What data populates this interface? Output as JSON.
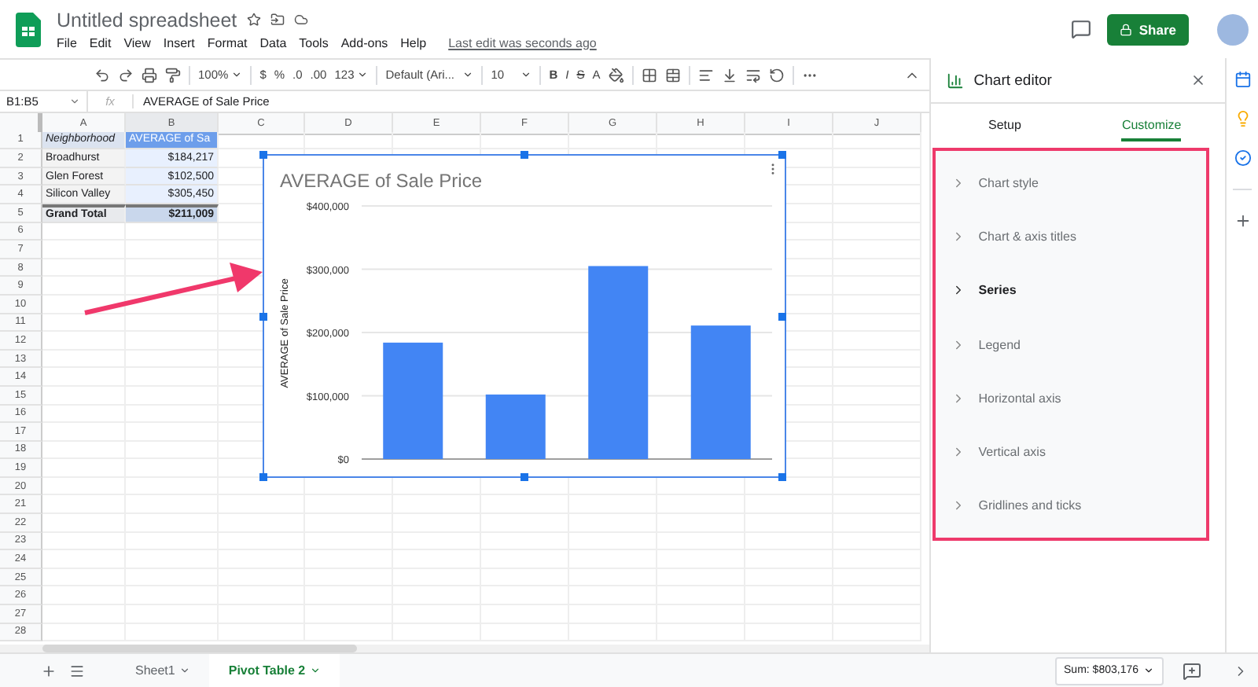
{
  "app": {
    "title": "Untitled spreadsheet",
    "menu": [
      "File",
      "Edit",
      "View",
      "Insert",
      "Format",
      "Data",
      "Tools",
      "Add-ons",
      "Help"
    ],
    "last_edit": "Last edit was seconds ago",
    "share_label": "Share"
  },
  "toolbar": {
    "zoom": "100%",
    "currency": "$",
    "percent": "%",
    "decrease_decimals": ".0",
    "increase_decimals": ".00",
    "more_formats": "123",
    "font": "Default (Ari...",
    "font_size": "10",
    "bold": "B",
    "italic": "I",
    "strikethrough": "S",
    "text_color": "A"
  },
  "formula_bar": {
    "range": "B1:B5",
    "fx": "fx",
    "formula": "AVERAGE of Sale Price"
  },
  "columns": [
    {
      "label": "A",
      "selected": false
    },
    {
      "label": "B",
      "selected": true
    },
    {
      "label": "C",
      "selected": false
    },
    {
      "label": "D",
      "selected": false
    },
    {
      "label": "E",
      "selected": false
    },
    {
      "label": "F",
      "selected": false
    },
    {
      "label": "G",
      "selected": false
    },
    {
      "label": "H",
      "selected": false
    },
    {
      "label": "I",
      "selected": false
    },
    {
      "label": "J",
      "selected": false
    }
  ],
  "row_numbers": [
    "1",
    "2",
    "3",
    "4",
    "5",
    "6",
    "7",
    "8",
    "9",
    "10",
    "11",
    "12",
    "13",
    "14",
    "15",
    "16",
    "17",
    "18",
    "19",
    "20",
    "21",
    "22",
    "23",
    "24",
    "25",
    "26",
    "27",
    "28"
  ],
  "pivot_rows": [
    {
      "kind": "header",
      "cells": [
        "Neighborhood",
        "AVERAGE of Sa"
      ]
    },
    {
      "kind": "data",
      "cells": [
        "Broadhurst",
        "$184,217"
      ]
    },
    {
      "kind": "data",
      "cells": [
        "Glen Forest",
        "$102,500"
      ]
    },
    {
      "kind": "data",
      "cells": [
        "Silicon Valley",
        "$305,450"
      ]
    },
    {
      "kind": "total",
      "cells": [
        "Grand Total",
        "$211,009"
      ]
    }
  ],
  "chart": {
    "chart_data": {
      "type": "bar",
      "title": "AVERAGE of Sale Price",
      "ylabel": "AVERAGE of Sale Price",
      "values": [
        184000,
        102000,
        305000,
        211000
      ],
      "grid": true,
      "ylim": [
        0,
        400000
      ],
      "yticks": [
        {
          "value": 0,
          "label": "$0"
        },
        {
          "value": 100000,
          "label": "$100,000"
        },
        {
          "value": 200000,
          "label": "$200,000"
        },
        {
          "value": 300000,
          "label": "$300,000"
        },
        {
          "value": 400000,
          "label": "$400,000"
        }
      ]
    }
  },
  "chart_editor": {
    "title": "Chart editor",
    "tabs": [
      {
        "label": "Setup",
        "selected": false
      },
      {
        "label": "Customize",
        "selected": true
      }
    ],
    "sections": [
      {
        "label": "Chart style",
        "highlighted": false
      },
      {
        "label": "Chart & axis titles",
        "highlighted": false
      },
      {
        "label": "Series",
        "highlighted": true
      },
      {
        "label": "Legend",
        "highlighted": false
      },
      {
        "label": "Horizontal axis",
        "highlighted": false
      },
      {
        "label": "Vertical axis",
        "highlighted": false
      },
      {
        "label": "Gridlines and ticks",
        "highlighted": false
      }
    ]
  },
  "sheet_tabs": [
    {
      "label": "Sheet1",
      "selected": false
    },
    {
      "label": "Pivot Table 2",
      "selected": true
    }
  ],
  "sum": "Sum: $803,176"
}
